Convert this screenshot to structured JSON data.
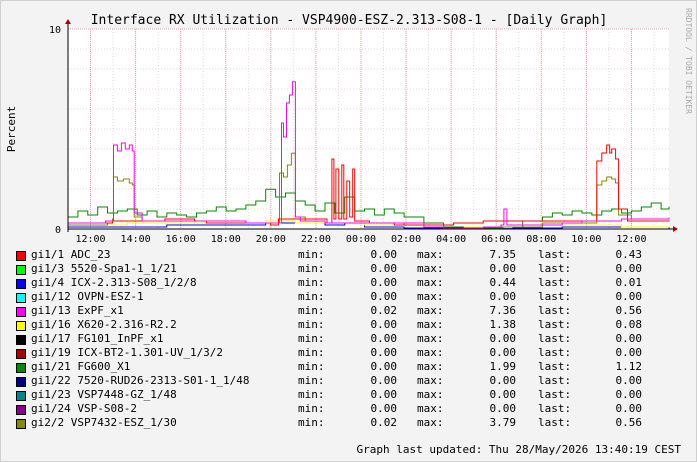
{
  "chart_data": {
    "type": "line",
    "title": "Interface RX Utilization - VSP4900-ESZ-2.313-S08-1 - [Daily Graph]",
    "ylabel": "Percent",
    "xlabel": "",
    "ylim": [
      0,
      10
    ],
    "yticks": [
      0,
      10
    ],
    "xlim": [
      "11:00",
      "13:40"
    ],
    "xticks": [
      "12:00",
      "14:00",
      "16:00",
      "18:00",
      "20:00",
      "22:00",
      "00:00",
      "02:00",
      "04:00",
      "06:00",
      "08:00",
      "10:00",
      "12:00"
    ],
    "grid": true,
    "watermark": "RRDTOOL / TOBI OETIKER",
    "footer": "Graph last updated: Thu 28/May/2026 13:40:19 CEST",
    "legend_labels": {
      "min": "min:",
      "max": "max:",
      "last": "last:"
    },
    "series": [
      {
        "name": "gi1/1 ADC_23",
        "color": "#ff0000",
        "min": "0.00",
        "max": "7.35",
        "last": "0.43",
        "points": [
          [
            0,
            0.3
          ],
          [
            45,
            0.4
          ],
          [
            90,
            0.4
          ],
          [
            98,
            0.5
          ],
          [
            128,
            0.4
          ],
          [
            140,
            0.3
          ],
          [
            170,
            0.3
          ],
          [
            205,
            0.2
          ],
          [
            213,
            0.5
          ],
          [
            250,
            0.5
          ],
          [
            262,
            0.3
          ],
          [
            267,
            3.5
          ],
          [
            269,
            0.5
          ],
          [
            271,
            3.0
          ],
          [
            274,
            0.5
          ],
          [
            277,
            3.2
          ],
          [
            279,
            0.5
          ],
          [
            282,
            2.4
          ],
          [
            285,
            0.6
          ],
          [
            288,
            3.0
          ],
          [
            290,
            0.4
          ],
          [
            300,
            0.4
          ],
          [
            305,
            0.3
          ],
          [
            330,
            0.2
          ],
          [
            360,
            0.2
          ],
          [
            390,
            0.3
          ],
          [
            420,
            0.4
          ],
          [
            480,
            0.4
          ],
          [
            525,
            0.4
          ],
          [
            535,
            3.4
          ],
          [
            540,
            3.8
          ],
          [
            545,
            4.2
          ],
          [
            548,
            3.8
          ],
          [
            550,
            4.0
          ],
          [
            554,
            3.5
          ],
          [
            557,
            1.0
          ],
          [
            566,
            0.4
          ],
          [
            600,
            0.4
          ],
          [
            608,
            0.43
          ]
        ]
      },
      {
        "name": "gi1/3 5520-Spa1-1_1/21",
        "color": "#00ff00",
        "min": "0.00",
        "max": "0.00",
        "last": "0.00",
        "points": [
          [
            0,
            0
          ],
          [
            608,
            0
          ]
        ]
      },
      {
        "name": "gi1/4 ICX-2.313-S08_1/2/8",
        "color": "#0000ff",
        "min": "0.00",
        "max": "0.44",
        "last": "0.01",
        "points": [
          [
            0,
            0.1
          ],
          [
            100,
            0.2
          ],
          [
            200,
            0.3
          ],
          [
            260,
            0.2
          ],
          [
            280,
            0.3
          ],
          [
            300,
            0.1
          ],
          [
            340,
            0.05
          ],
          [
            400,
            0.02
          ],
          [
            450,
            0.05
          ],
          [
            500,
            0.1
          ],
          [
            560,
            0.1
          ],
          [
            608,
            0.01
          ]
        ]
      },
      {
        "name": "gi1/12 OVPN-ESZ-1",
        "color": "#00ffff",
        "min": "0.00",
        "max": "0.00",
        "last": "0.00",
        "points": [
          [
            0,
            0
          ],
          [
            608,
            0
          ]
        ]
      },
      {
        "name": "gi1/13 ExPF_x1",
        "color": "#ff00ff",
        "min": "0.02",
        "max": "7.36",
        "last": "0.56",
        "points": [
          [
            0,
            0.3
          ],
          [
            38,
            0.4
          ],
          [
            45,
            0.4
          ],
          [
            46,
            4.2
          ],
          [
            50,
            3.9
          ],
          [
            54,
            4.3
          ],
          [
            58,
            4.0
          ],
          [
            62,
            4.2
          ],
          [
            65,
            3.9
          ],
          [
            67,
            0.8
          ],
          [
            75,
            0.4
          ],
          [
            120,
            0.4
          ],
          [
            180,
            0.3
          ],
          [
            210,
            0.3
          ],
          [
            216,
            5.3
          ],
          [
            218,
            4.6
          ],
          [
            221,
            6.3
          ],
          [
            224,
            6.7
          ],
          [
            227,
            7.36
          ],
          [
            230,
            0.6
          ],
          [
            235,
            0.4
          ],
          [
            260,
            0.3
          ],
          [
            300,
            0.3
          ],
          [
            330,
            0.3
          ],
          [
            360,
            0.1
          ],
          [
            380,
            0.02
          ],
          [
            420,
            0.1
          ],
          [
            438,
            0.2
          ],
          [
            441,
            1.0
          ],
          [
            444,
            0.2
          ],
          [
            500,
            0.3
          ],
          [
            520,
            0.4
          ],
          [
            560,
            0.5
          ],
          [
            608,
            0.56
          ]
        ]
      },
      {
        "name": "gi1/16 X620-2.316-R2.2",
        "color": "#ffff00",
        "min": "0.00",
        "max": "1.38",
        "last": "0.08",
        "points": [
          [
            0,
            0.2
          ],
          [
            60,
            0.3
          ],
          [
            120,
            0.3
          ],
          [
            200,
            0.4
          ],
          [
            230,
            0.3
          ],
          [
            300,
            0.2
          ],
          [
            360,
            0.1
          ],
          [
            420,
            0.1
          ],
          [
            480,
            0.2
          ],
          [
            560,
            0.1
          ],
          [
            608,
            0.08
          ]
        ]
      },
      {
        "name": "gi1/17 FG101_InPF_x1",
        "color": "#000000",
        "min": "0.00",
        "max": "0.00",
        "last": "0.00",
        "points": [
          [
            0,
            0
          ],
          [
            608,
            0
          ]
        ]
      },
      {
        "name": "gi1/19 ICX-BT2-1.301-UV_1/3/2",
        "color": "#aa0000",
        "min": "0.00",
        "max": "0.00",
        "last": "0.00",
        "points": [
          [
            0,
            0
          ],
          [
            608,
            0
          ]
        ]
      },
      {
        "name": "gi1/21 FG600_X1",
        "color": "#008800",
        "min": "0.00",
        "max": "1.99",
        "last": "1.12",
        "points": [
          [
            0,
            0.6
          ],
          [
            10,
            0.9
          ],
          [
            20,
            0.7
          ],
          [
            30,
            1.1
          ],
          [
            40,
            0.8
          ],
          [
            50,
            0.9
          ],
          [
            60,
            1.0
          ],
          [
            70,
            0.7
          ],
          [
            80,
            0.9
          ],
          [
            90,
            0.6
          ],
          [
            100,
            0.8
          ],
          [
            110,
            0.7
          ],
          [
            120,
            0.6
          ],
          [
            130,
            0.8
          ],
          [
            140,
            0.9
          ],
          [
            150,
            1.1
          ],
          [
            160,
            0.9
          ],
          [
            170,
            1.0
          ],
          [
            180,
            1.2
          ],
          [
            190,
            1.4
          ],
          [
            200,
            1.99
          ],
          [
            210,
            1.6
          ],
          [
            220,
            1.8
          ],
          [
            230,
            1.4
          ],
          [
            240,
            1.2
          ],
          [
            250,
            0.9
          ],
          [
            260,
            1.3
          ],
          [
            270,
            0.8
          ],
          [
            280,
            1.6
          ],
          [
            290,
            0.9
          ],
          [
            300,
            1.0
          ],
          [
            310,
            0.7
          ],
          [
            320,
            1.0
          ],
          [
            330,
            0.8
          ],
          [
            340,
            0.6
          ],
          [
            360,
            0.3
          ],
          [
            380,
            0.1
          ],
          [
            400,
            0.05
          ],
          [
            420,
            0.05
          ],
          [
            440,
            0.1
          ],
          [
            460,
            0.4
          ],
          [
            480,
            0.6
          ],
          [
            490,
            0.8
          ],
          [
            500,
            0.7
          ],
          [
            510,
            0.9
          ],
          [
            520,
            0.8
          ],
          [
            530,
            0.7
          ],
          [
            540,
            0.9
          ],
          [
            550,
            1.0
          ],
          [
            560,
            0.8
          ],
          [
            570,
            0.9
          ],
          [
            580,
            1.1
          ],
          [
            590,
            1.3
          ],
          [
            600,
            1.0
          ],
          [
            608,
            1.12
          ]
        ]
      },
      {
        "name": "gi1/22 7520-RUD26-2313-S01-1_1/48",
        "color": "#000080",
        "min": "0.00",
        "max": "0.00",
        "last": "0.00",
        "points": [
          [
            0,
            0
          ],
          [
            608,
            0
          ]
        ]
      },
      {
        "name": "gi1/23 VSP7448-GZ_1/48",
        "color": "#008888",
        "min": "0.00",
        "max": "0.00",
        "last": "0.00",
        "points": [
          [
            0,
            0
          ],
          [
            608,
            0
          ]
        ]
      },
      {
        "name": "gi1/24 VSP-S08-2",
        "color": "#880088",
        "min": "0.00",
        "max": "0.00",
        "last": "0.00",
        "points": [
          [
            0,
            0
          ],
          [
            608,
            0
          ]
        ]
      },
      {
        "name": "gi2/2 VSP7432-ESZ_1/30",
        "color": "#888800",
        "min": "0.02",
        "max": "3.79",
        "last": "0.56",
        "points": [
          [
            0,
            0.2
          ],
          [
            40,
            0.3
          ],
          [
            45,
            0.5
          ],
          [
            46,
            2.6
          ],
          [
            50,
            2.4
          ],
          [
            56,
            2.5
          ],
          [
            62,
            2.3
          ],
          [
            65,
            2.2
          ],
          [
            67,
            0.6
          ],
          [
            75,
            0.4
          ],
          [
            120,
            0.4
          ],
          [
            180,
            0.3
          ],
          [
            210,
            0.3
          ],
          [
            214,
            2.8
          ],
          [
            218,
            2.6
          ],
          [
            222,
            3.2
          ],
          [
            226,
            3.79
          ],
          [
            230,
            0.6
          ],
          [
            240,
            0.4
          ],
          [
            260,
            0.3
          ],
          [
            300,
            0.3
          ],
          [
            340,
            0.2
          ],
          [
            380,
            0.02
          ],
          [
            420,
            0.1
          ],
          [
            480,
            0.3
          ],
          [
            520,
            0.3
          ],
          [
            535,
            2.2
          ],
          [
            540,
            2.4
          ],
          [
            545,
            2.6
          ],
          [
            550,
            2.5
          ],
          [
            554,
            2.3
          ],
          [
            557,
            0.7
          ],
          [
            570,
            0.5
          ],
          [
            608,
            0.56
          ]
        ]
      }
    ]
  }
}
